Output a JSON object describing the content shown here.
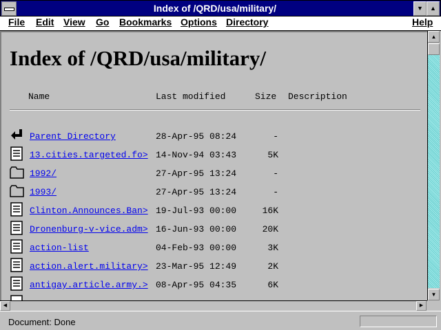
{
  "window": {
    "title": "Index of /QRD/usa/military/"
  },
  "menu": [
    "File",
    "Edit",
    "View",
    "Go",
    "Bookmarks",
    "Options",
    "Directory",
    "Help"
  ],
  "page": {
    "heading": "Index of /QRD/usa/military/",
    "columns": {
      "name": "Name",
      "modified": "Last modified",
      "size": "Size",
      "description": "Description"
    },
    "entries": [
      {
        "icon": "back-arrow-icon",
        "name": "Parent Directory",
        "modified": "28-Apr-95 08:24",
        "size": "-"
      },
      {
        "icon": "text-file-icon",
        "name": "13.cities.targeted.fo>",
        "modified": "14-Nov-94 03:43",
        "size": "5K"
      },
      {
        "icon": "folder-icon",
        "name": "1992/",
        "modified": "27-Apr-95 13:24",
        "size": "-"
      },
      {
        "icon": "folder-icon",
        "name": "1993/",
        "modified": "27-Apr-95 13:24",
        "size": "-"
      },
      {
        "icon": "text-file-icon",
        "name": "Clinton.Announces.Ban>",
        "modified": "19-Jul-93 00:00",
        "size": "16K"
      },
      {
        "icon": "text-file-icon",
        "name": "Dronenburg-v-vice.adm>",
        "modified": "16-Jun-93 00:00",
        "size": "20K"
      },
      {
        "icon": "text-file-icon",
        "name": "action-list",
        "modified": "04-Feb-93 00:00",
        "size": "3K"
      },
      {
        "icon": "text-file-icon",
        "name": "action.alert.military>",
        "modified": "23-Mar-95 12:49",
        "size": "2K"
      },
      {
        "icon": "text-file-icon",
        "name": "antigay.article.army.>",
        "modified": "08-Apr-95 04:35",
        "size": "6K"
      }
    ]
  },
  "status": {
    "text": "Document: Done"
  },
  "colors": {
    "titlebar": "#000080",
    "link": "#0000ee",
    "background": "#c0c0c0",
    "scrollbar_track": "#7fd0d0"
  }
}
